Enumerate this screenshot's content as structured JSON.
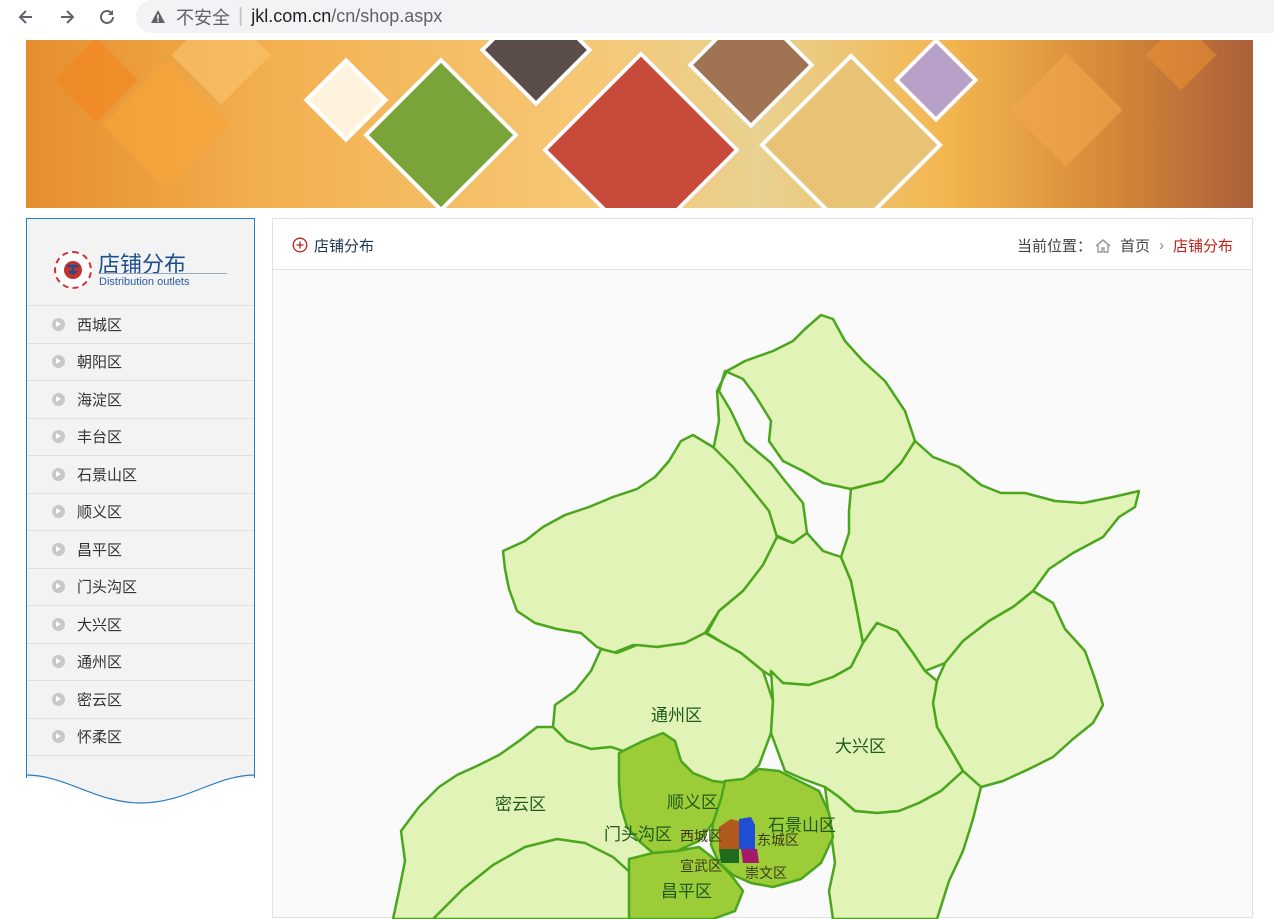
{
  "browser": {
    "security": "不安全",
    "url_host": "jkl.com.cn",
    "url_path": "/cn/shop.aspx"
  },
  "sidebar": {
    "title": "店铺分布",
    "subtitle": "Distribution outlets",
    "items": [
      {
        "label": "西城区"
      },
      {
        "label": "朝阳区"
      },
      {
        "label": "海淀区"
      },
      {
        "label": "丰台区"
      },
      {
        "label": "石景山区"
      },
      {
        "label": "顺义区"
      },
      {
        "label": "昌平区"
      },
      {
        "label": "门头沟区"
      },
      {
        "label": "大兴区"
      },
      {
        "label": "通州区"
      },
      {
        "label": "密云区"
      },
      {
        "label": "怀柔区"
      }
    ]
  },
  "panel": {
    "title": "店铺分布",
    "breadcrumb_label": "当前位置：",
    "breadcrumb_home": "首页",
    "breadcrumb_current": "店铺分布"
  },
  "map": {
    "labels": {
      "tongzhou": "通州区",
      "daxing": "大兴区",
      "miyun": "密云区",
      "shunyi": "顺义区",
      "mentougou": "门头沟区",
      "shijingshan": "石景山区",
      "xicheng": "西城区",
      "dongcheng": "东城区",
      "xuanwu": "宣武区",
      "chongwen": "崇文区",
      "changping": "昌平区"
    },
    "colors": {
      "light_region": "#e2f3b8",
      "highlight_region": "#9ccc38",
      "border": "#4aa61c",
      "xicheng": "#b05a1e",
      "dongcheng": "#1f4fd2",
      "xuanwu": "#1f6b1f",
      "chongwen": "#a41a6a"
    }
  }
}
